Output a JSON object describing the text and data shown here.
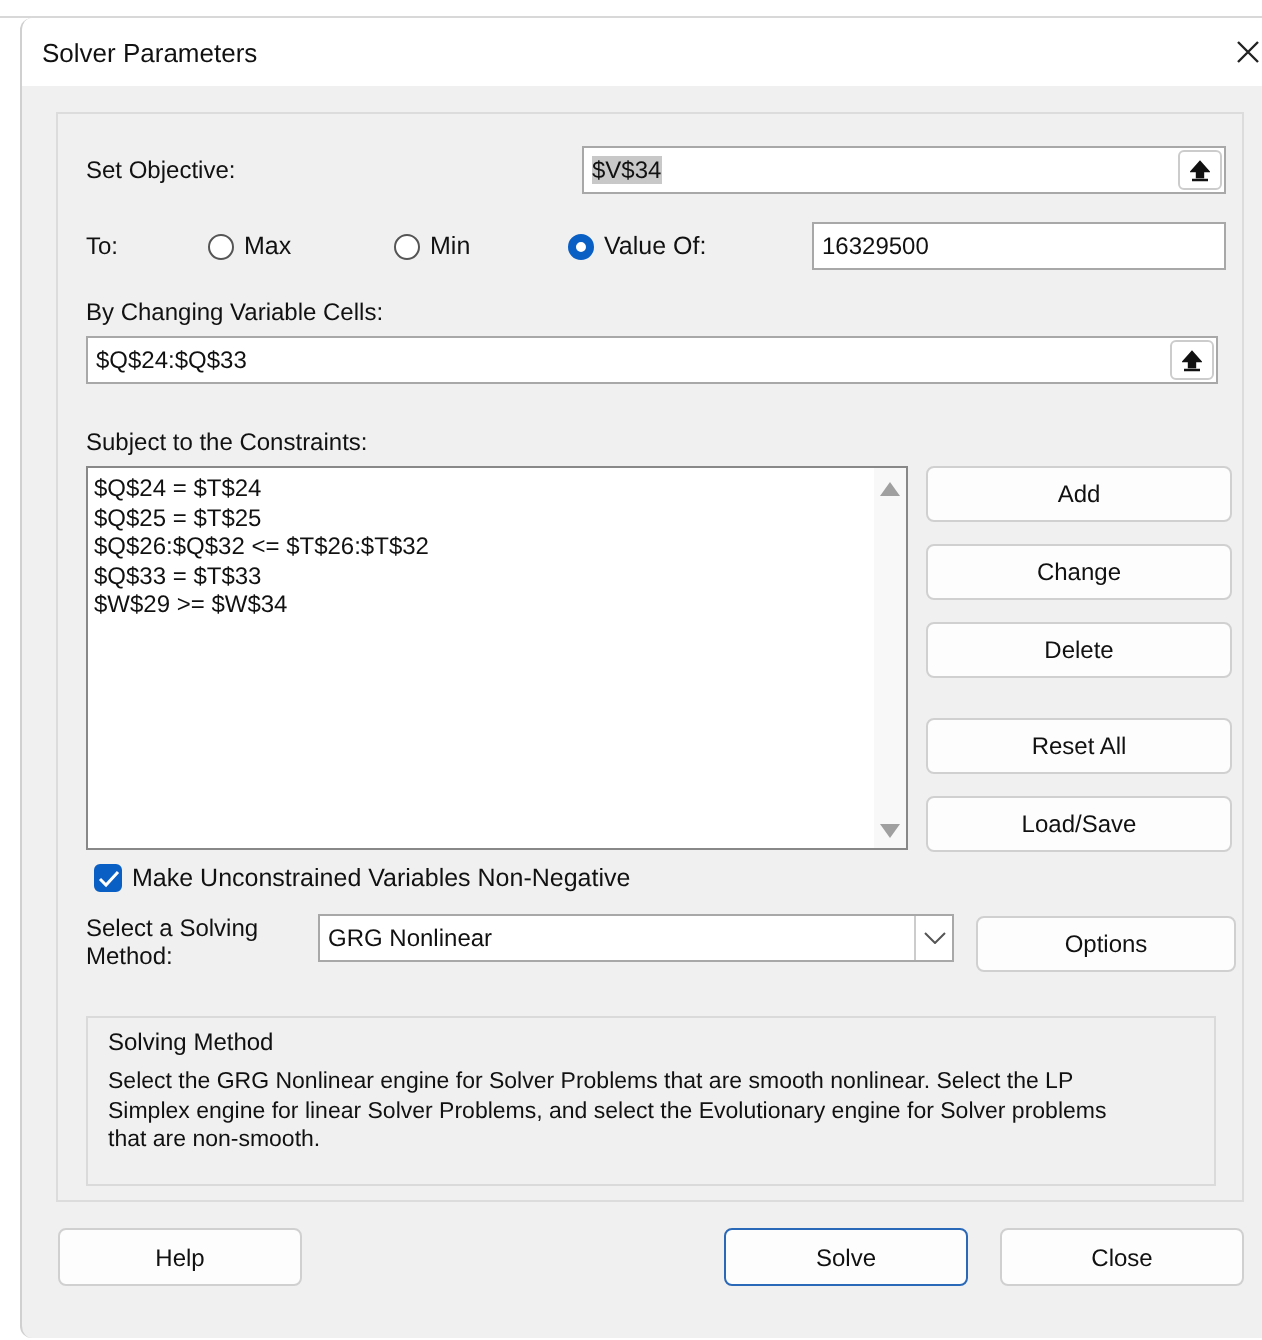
{
  "window": {
    "title": "Solver Parameters"
  },
  "objective": {
    "label": "Set Objective:",
    "value": "$V$34",
    "text_selected": true
  },
  "to": {
    "label": "To:",
    "options": [
      {
        "label": "Max",
        "selected": false
      },
      {
        "label": "Min",
        "selected": false
      },
      {
        "label": "Value Of:",
        "selected": true
      }
    ],
    "value": "16329500"
  },
  "variable_cells": {
    "label": "By Changing Variable Cells:",
    "value": "$Q$24:$Q$33"
  },
  "constraints": {
    "label": "Subject to the Constraints:",
    "items": [
      "$Q$24 = $T$24",
      "$Q$25 = $T$25",
      "$Q$26:$Q$32 <= $T$26:$T$32",
      "$Q$33 = $T$33",
      "$W$29 >= $W$34"
    ]
  },
  "constraint_buttons": [
    "Add",
    "Change",
    "Delete",
    "Reset All",
    "Load/Save"
  ],
  "non_negative": {
    "label": "Make Unconstrained Variables Non-Negative",
    "checked": true
  },
  "solving_method": {
    "label": "Select a Solving Method:",
    "value": "GRG Nonlinear",
    "options_button": "Options"
  },
  "description": {
    "title": "Solving Method",
    "text": "Select the GRG Nonlinear engine for Solver Problems that are smooth nonlinear. Select the LP Simplex engine for linear Solver Problems, and select the Evolutionary engine for Solver problems that are non-smooth."
  },
  "buttons": [
    {
      "label": "Help",
      "default": false
    },
    {
      "label": "Solve",
      "default": true
    },
    {
      "label": "Close",
      "default": false
    }
  ]
}
